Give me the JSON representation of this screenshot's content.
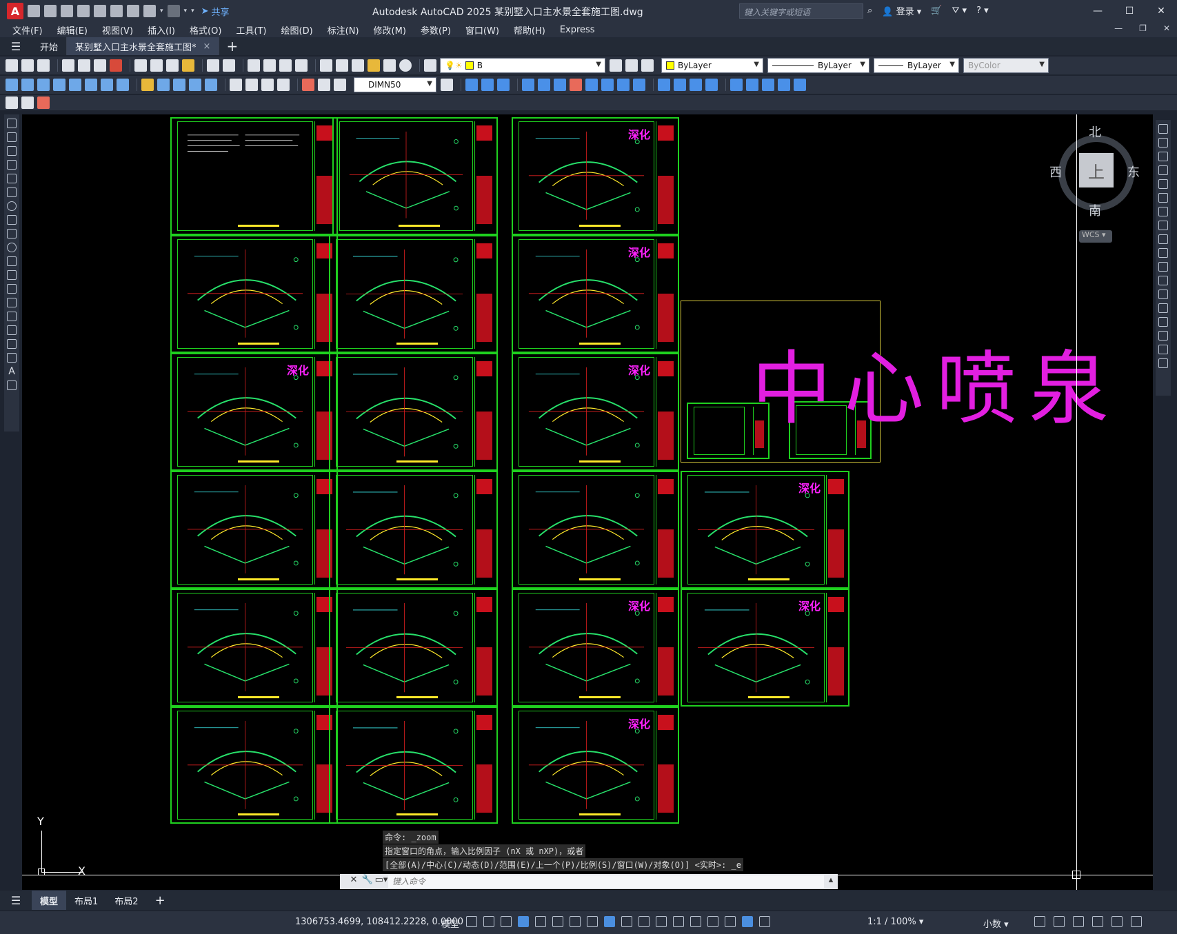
{
  "app": {
    "logo": "A",
    "title": "Autodesk AutoCAD 2025    某别墅入口主水景全套施工图.dwg",
    "share_label": "共享",
    "search_placeholder": "键入关键字或短语",
    "login_label": "登录"
  },
  "menu": [
    "文件(F)",
    "编辑(E)",
    "视图(V)",
    "插入(I)",
    "格式(O)",
    "工具(T)",
    "绘图(D)",
    "标注(N)",
    "修改(M)",
    "参数(P)",
    "窗口(W)",
    "帮助(H)",
    "Express"
  ],
  "tabs": {
    "start": "开始",
    "active": "某别墅入口主水景全套施工图*",
    "close": "×",
    "add": "+"
  },
  "toolbar": {
    "layer_name": "B",
    "color": "ByLayer",
    "linetype": "ByLayer",
    "lineweight": "ByLayer",
    "plotstyle": "ByColor",
    "dimstyle": "DIMN50"
  },
  "drawing": {
    "stamp": "深化",
    "fountain_title": "中心喷泉"
  },
  "viewcube": {
    "north": "北",
    "south": "南",
    "east": "东",
    "west": "西",
    "top": "上",
    "wcs": "WCS"
  },
  "ucs": {
    "x": "X",
    "y": "Y"
  },
  "command": {
    "history": [
      "命令: _zoom",
      "指定窗口的角点，输入比例因子 (nX 或 nXP)，或者",
      "[全部(A)/中心(C)/动态(D)/范围(E)/上一个(P)/比例(S)/窗口(W)/对象(O)] <实时>: _e"
    ],
    "placeholder": "键入命令"
  },
  "layout_tabs": [
    "模型",
    "布局1",
    "布局2"
  ],
  "status": {
    "coords": "1306753.4699, 108412.2228, 0.0000",
    "space": "模型",
    "scale": "1:1 / 100%",
    "units": "小数"
  },
  "colors": {
    "frame": "#1fd11f",
    "stamp": "#ff22ff",
    "title_block_red": "#c8101c",
    "fountain_text": "#e21fe0",
    "fountain_frame": "#d7c93a"
  }
}
